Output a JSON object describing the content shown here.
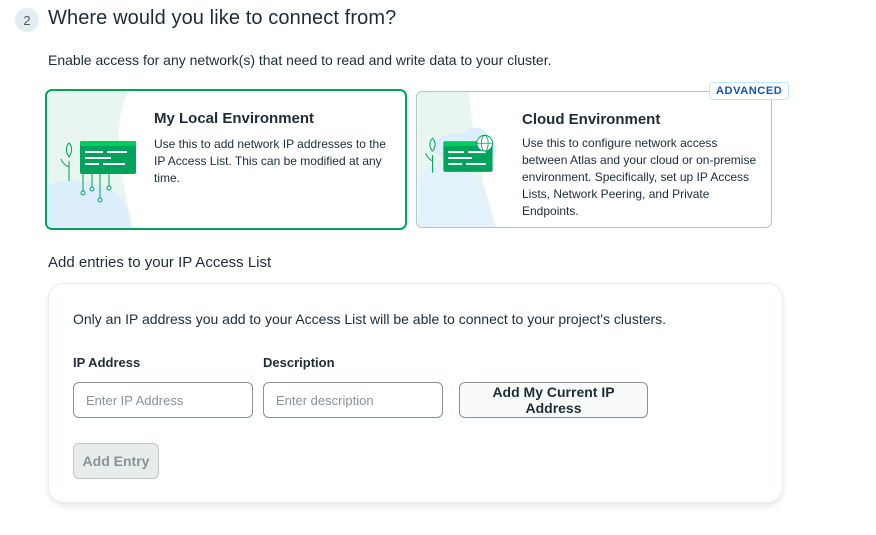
{
  "step": {
    "number": "2",
    "title": "Where would you like to connect from?"
  },
  "subtitle": "Enable access for any network(s) that need to read and write data to your cluster.",
  "options": {
    "local": {
      "title": "My Local Environment",
      "description": "Use this to add network IP addresses to the IP Access List. This can be modified at any time.",
      "icon": "local-network-icon",
      "selected": true
    },
    "cloud": {
      "badge": "ADVANCED",
      "title": "Cloud Environment",
      "description": "Use this to configure network access between Atlas and your cloud or on-premise environment. Specifically, set up IP Access Lists, Network Peering, and Private Endpoints.",
      "icon": "cloud-network-icon",
      "selected": false
    }
  },
  "access_list": {
    "title": "Add entries to your IP Access List",
    "note": "Only an IP address you add to your Access List will be able to connect to your project's clusters.",
    "ip_label": "IP Address",
    "ip_placeholder": "Enter IP Address",
    "ip_value": "",
    "description_label": "Description",
    "description_placeholder": "Enter description",
    "description_value": "",
    "current_ip_button": "Add My Current IP Address",
    "add_entry_button": "Add Entry"
  },
  "colors": {
    "accent_green": "#00a35c",
    "badge_blue": "#1254b7",
    "text": "#1c2d38"
  }
}
